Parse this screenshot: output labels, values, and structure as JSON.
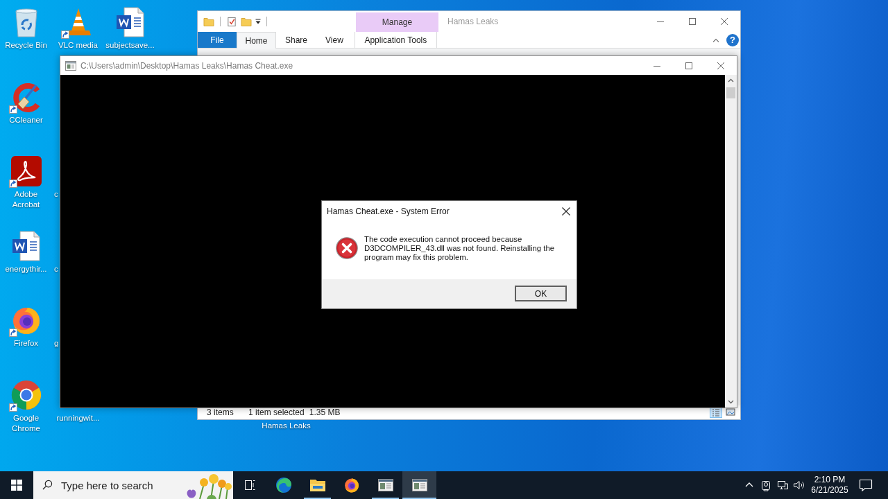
{
  "desktop": {
    "icons": [
      {
        "label": "Recycle Bin",
        "kind": "recycle-bin",
        "shortcut": false
      },
      {
        "label": "CCleaner",
        "kind": "ccleaner",
        "shortcut": true
      },
      {
        "label": "Adobe Acrobat",
        "kind": "acrobat",
        "shortcut": true
      },
      {
        "label": "energythir...",
        "kind": "word",
        "shortcut": false
      },
      {
        "label": "Firefox",
        "kind": "firefox",
        "shortcut": true
      },
      {
        "label": "Google Chrome",
        "kind": "chrome",
        "shortcut": true
      },
      {
        "label": "VLC media",
        "kind": "vlc",
        "shortcut": true
      },
      {
        "label": "subjectsave...",
        "kind": "word",
        "shortcut": false
      }
    ],
    "covered_labels": [
      {
        "label": "c",
        "kind": "cut"
      },
      {
        "label": "c",
        "kind": "cut"
      },
      {
        "label": "g",
        "kind": "cut"
      },
      {
        "label": "runningwit...",
        "kind": "whole"
      },
      {
        "label": "Hamas Leaks",
        "kind": "peek"
      }
    ]
  },
  "explorer": {
    "title": "Hamas Leaks",
    "context_group": "Manage",
    "tabs": [
      {
        "label": "File",
        "kind": "file",
        "selected": false
      },
      {
        "label": "Home",
        "kind": "tab",
        "selected": true
      },
      {
        "label": "Share",
        "kind": "tab",
        "selected": false
      },
      {
        "label": "View",
        "kind": "tab",
        "selected": false
      },
      {
        "label": "Application Tools",
        "kind": "context",
        "selected": false
      }
    ],
    "help": "?",
    "status_bar": {
      "items": "3 items",
      "selection": "1 item selected",
      "size": "1.35 MB"
    },
    "view_buttons": [
      {
        "kind": "details",
        "selected": true
      },
      {
        "kind": "large-icons",
        "selected": false
      }
    ]
  },
  "console": {
    "title": "C:\\Users\\admin\\Desktop\\Hamas Leaks\\Hamas Cheat.exe"
  },
  "dialog": {
    "title": "Hamas Cheat.exe - System Error",
    "message": "The code execution cannot proceed because D3DCOMPILER_43.dll was not found. Reinstalling the program may fix this problem.",
    "button": "OK"
  },
  "taskbar": {
    "search": {
      "placeholder": "Type here to search"
    },
    "apps": [
      {
        "kind": "edge",
        "open": false,
        "selected": false
      },
      {
        "kind": "file-explorer",
        "open": true,
        "selected": false
      },
      {
        "kind": "firefox",
        "open": false,
        "selected": false
      },
      {
        "kind": "console",
        "open": true,
        "selected": false
      },
      {
        "kind": "console",
        "open": true,
        "selected": true
      }
    ],
    "clock": {
      "time": "2:10 PM",
      "date": "6/21/2025"
    }
  }
}
